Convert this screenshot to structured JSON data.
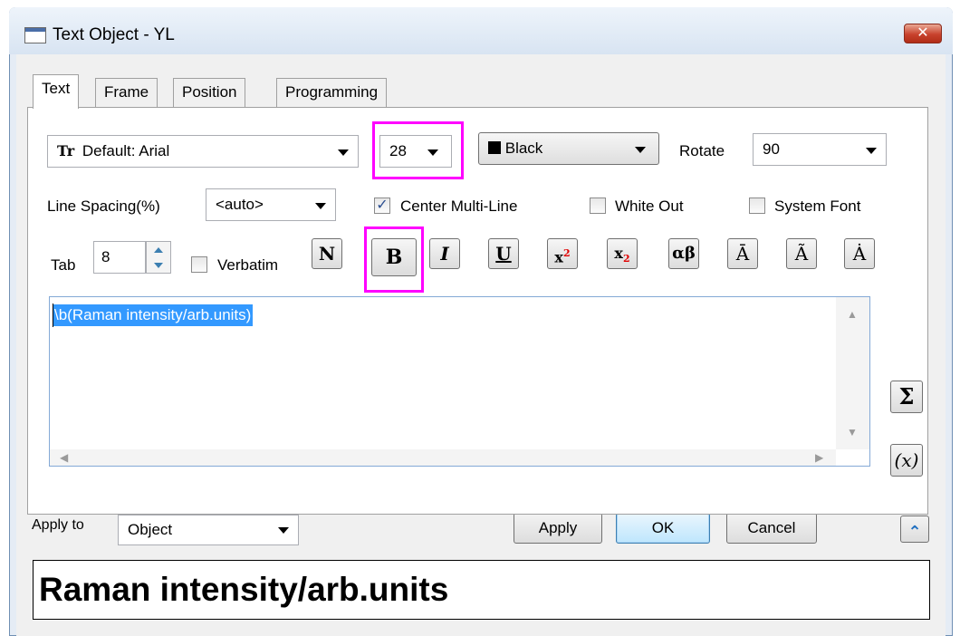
{
  "window": {
    "title": "Text Object - YL",
    "close_label": "✕"
  },
  "tabs": [
    {
      "label": "Text",
      "active": true
    },
    {
      "label": "Frame",
      "active": false
    },
    {
      "label": "Position",
      "active": false
    },
    {
      "label": "Programming",
      "active": false
    }
  ],
  "font": {
    "icon_glyph": "Tr",
    "value": "Default: Arial"
  },
  "size": {
    "value": "28"
  },
  "color": {
    "value": "Black",
    "swatch": "#000000"
  },
  "rotate": {
    "label": "Rotate",
    "value": "90"
  },
  "line_spacing": {
    "label": "Line Spacing(%)",
    "value": "<auto>"
  },
  "options": {
    "center_multi_line": {
      "label": "Center Multi-Line",
      "checked": true,
      "mark": "✓"
    },
    "white_out": {
      "label": "White Out",
      "checked": false
    },
    "system_font": {
      "label": "System Font",
      "checked": false
    },
    "verbatim": {
      "label": "Verbatim",
      "checked": false
    }
  },
  "tab": {
    "label": "Tab",
    "value": "8"
  },
  "format_buttons": {
    "normal": "N",
    "bold": "B",
    "italic": "I",
    "underline": "U",
    "superscript_base": "x",
    "superscript_exp": "2",
    "subscript_base": "x",
    "subscript_exp": "2",
    "greek": "αβ",
    "overbar": "Ā",
    "tilde": "Ã",
    "dot": "Ȧ"
  },
  "editor": {
    "content": "\\b(Raman intensity/arb.units)"
  },
  "side_buttons": {
    "sigma": "Σ",
    "variable": "(x)"
  },
  "apply_to": {
    "label": "Apply to",
    "value": "Object"
  },
  "buttons": {
    "apply": "Apply",
    "ok": "OK",
    "cancel": "Cancel",
    "collapse_glyph": "⌃"
  },
  "preview": {
    "text": "Raman intensity/arb.units"
  },
  "colors": {
    "highlight": "#ff00ff",
    "selection": "#3399ff",
    "sup_sub": "#e00000"
  }
}
